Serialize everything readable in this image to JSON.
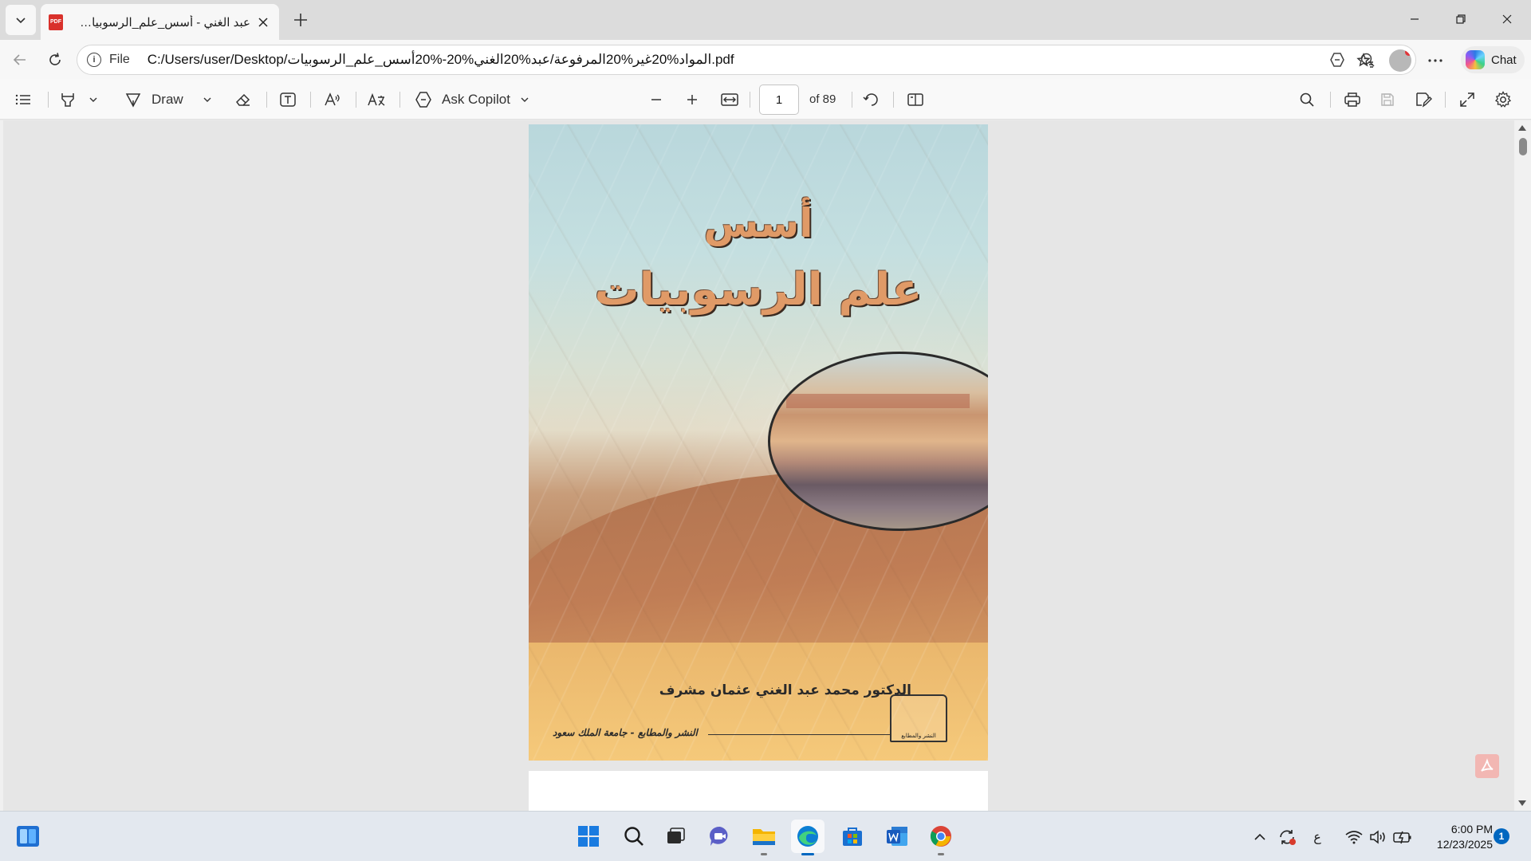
{
  "browser": {
    "tab": {
      "title": "عبد الغني - أسس_علم_الرسوبيات.pdf",
      "favicon": "PDF"
    },
    "address": {
      "scheme": "File",
      "url": "C:/Users/user/Desktop/المواد%20غير%20المرفوعة/عبد%20الغني%20-%20أسس_علم_الرسوبيات.pdf"
    },
    "chat_label": "Chat"
  },
  "pdf_toolbar": {
    "draw_label": "Draw",
    "copilot_label": "Ask Copilot",
    "page_current": "1",
    "page_total": "of 89"
  },
  "document": {
    "cover_title_line1": "أسس",
    "cover_title_line2": "علم الرسوبيات",
    "cover_author": "الدكتور محمد عبد الغني عثمان مشرف",
    "cover_publisher": "النشر والمطابع - جامعة الملك سعود",
    "emblem_text": "النشر والمطابع"
  },
  "taskbar": {
    "keyboard_lang": "ع",
    "time": "6:00 PM",
    "date": "12/23/2025",
    "notifications": "1"
  },
  "colors": {
    "accent": "#0067c0",
    "pdf_badge": "#d9312b"
  }
}
